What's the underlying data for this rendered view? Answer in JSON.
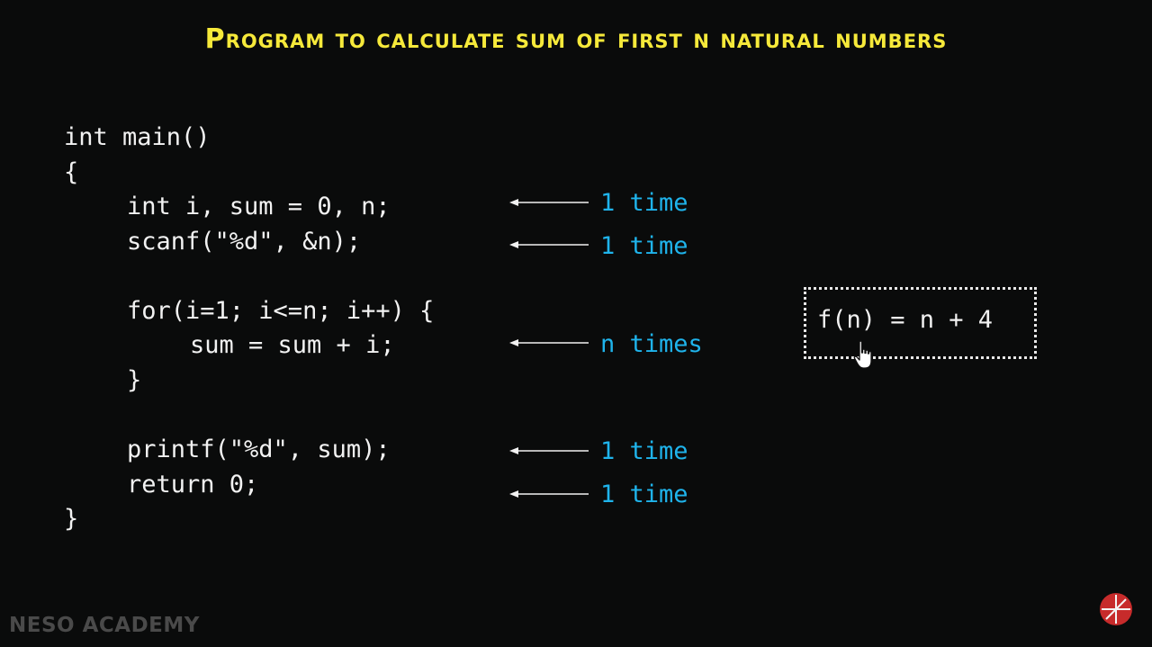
{
  "slide": {
    "title": "Program to calculate sum of first n natural numbers",
    "code_lines": [
      "int main()",
      "{",
      "int i, sum = 0, n;",
      "scanf(\"%d\", &n);",
      "for(i=1; i<=n; i++) {",
      "sum = sum + i;",
      "}",
      "printf(\"%d\", sum);",
      "return 0;",
      "}"
    ],
    "annotations": [
      "1 time",
      "1 time",
      "n times",
      "1 time",
      "1 time"
    ],
    "formula": "f(n) = n + 4"
  },
  "branding": {
    "watermark": "NESO ACADEMY",
    "logo_icon": "neso-academy-logo-icon"
  },
  "colors": {
    "background": "#0a0b0b",
    "title": "#f6e93a",
    "code": "#f2f2f2",
    "annotation": "#1fb4ec",
    "logo": "#c72b2b"
  }
}
